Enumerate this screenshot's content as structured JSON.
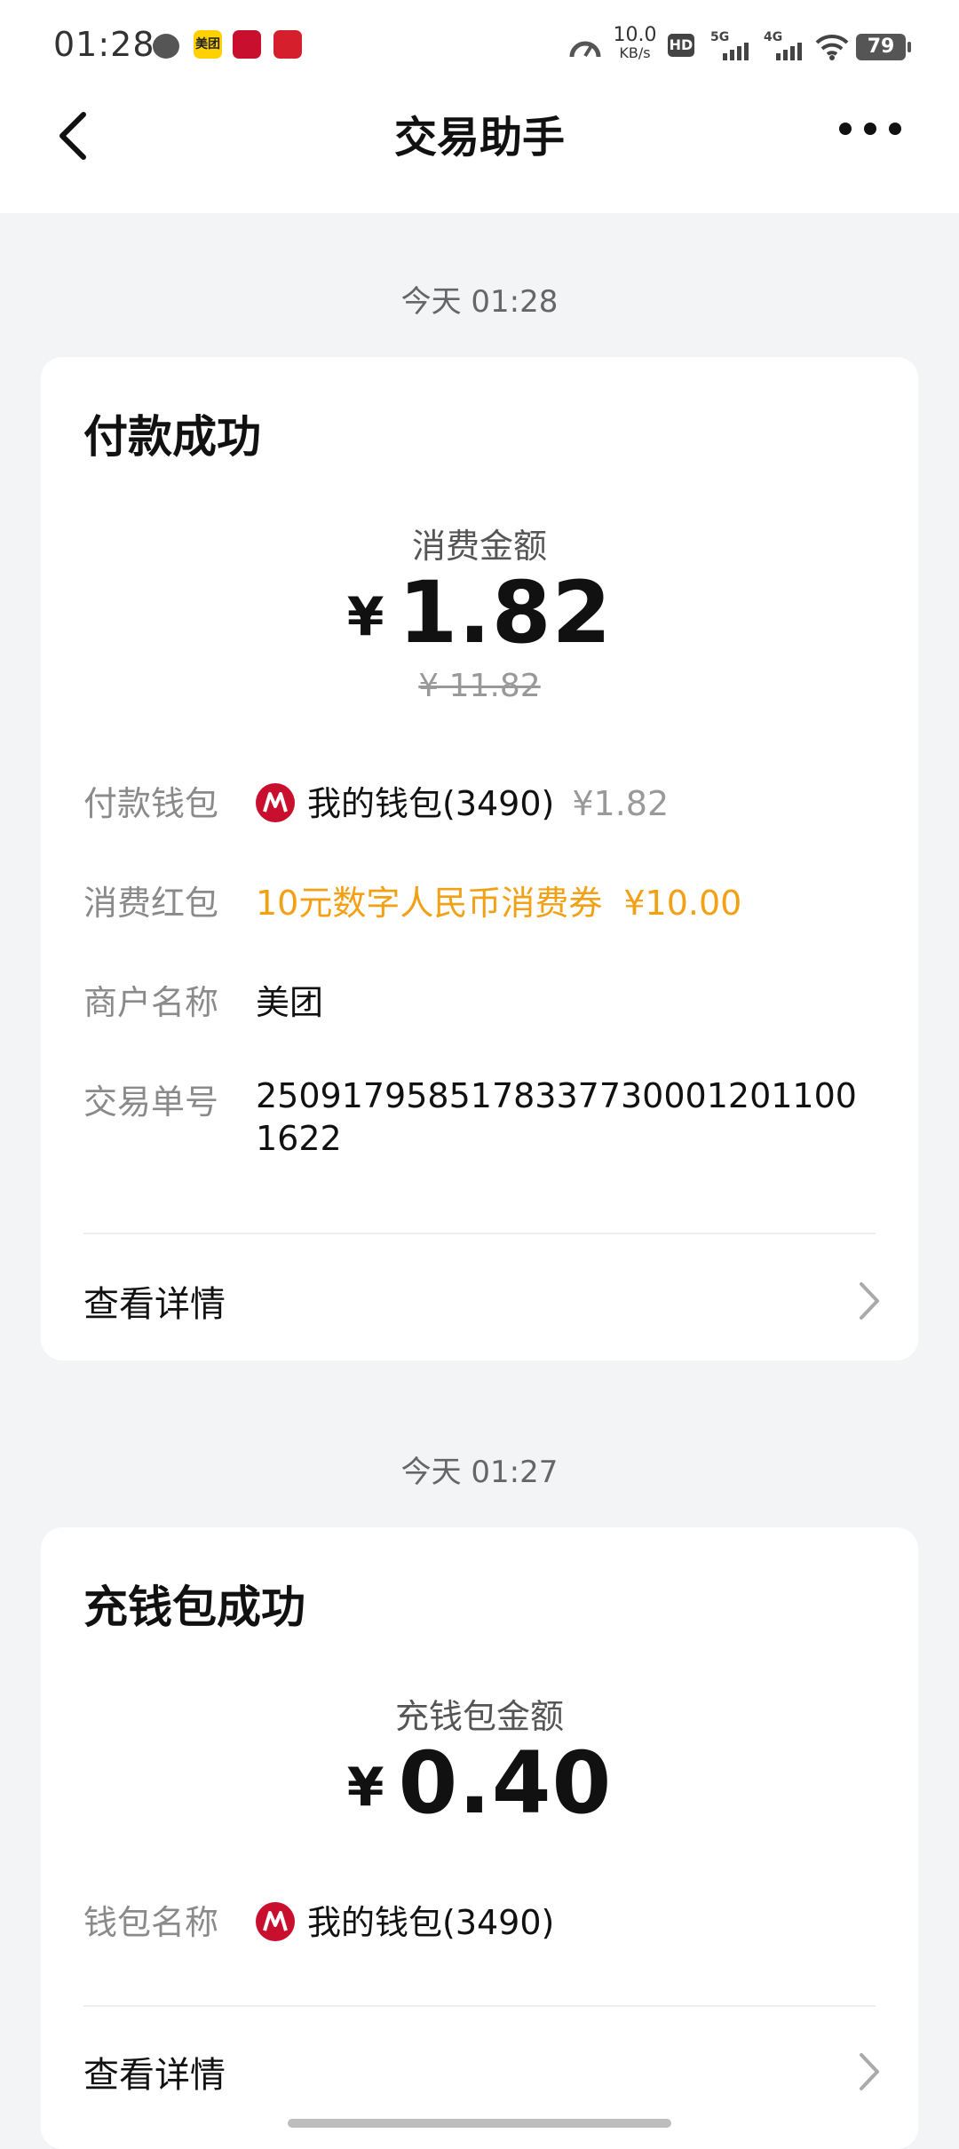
{
  "status": {
    "time": "01:28",
    "net_speed": "10.0",
    "net_unit": "KB/s",
    "hd": "HD",
    "sig1": "5G",
    "sig2": "4G",
    "battery": "79",
    "notif_meituan": "美团"
  },
  "nav": {
    "title": "交易助手"
  },
  "tx1": {
    "timestamp": "今天 01:28",
    "title": "付款成功",
    "amount_label": "消费金额",
    "currency": "¥",
    "amount": "1.82",
    "original_amount": "¥ 11.82",
    "rows": [
      {
        "label": "付款钱包",
        "value": "我的钱包(3490)",
        "sub": "¥1.82"
      },
      {
        "label": "消费红包",
        "value": "10元数字人民币消费券",
        "sub": "¥10.00"
      },
      {
        "label": "商户名称",
        "value": "美团"
      },
      {
        "label": "交易单号",
        "value_line1": "25091795851783377300012011001622"
      }
    ],
    "detail": "查看详情"
  },
  "tx2": {
    "timestamp": "今天 01:27",
    "title": "充钱包成功",
    "amount_label": "充钱包金额",
    "currency": "¥",
    "amount": "0.40",
    "rows": [
      {
        "label": "钱包名称",
        "value": "我的钱包(3490)"
      }
    ],
    "detail": "查看详情"
  },
  "colors": {
    "accent_orange": "#f2a014",
    "brand_red": "#c8102e",
    "bg": "#f3f4f6"
  }
}
